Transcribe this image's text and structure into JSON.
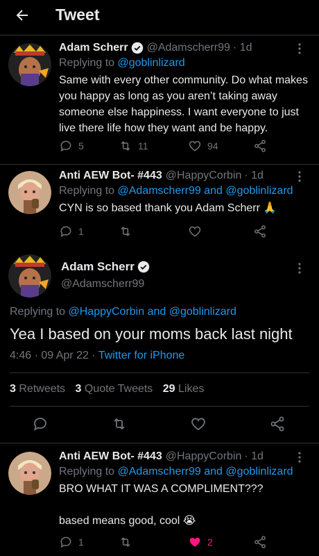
{
  "header": {
    "title": "Tweet"
  },
  "tweets": [
    {
      "name": "Adam Scherr",
      "handle": "@Adamscherr99",
      "time": "· 1d",
      "replying_prefix": "Replying to ",
      "replying_to": "@goblinlizard",
      "text": "Same with every other community.  Do what makes you happy as long as you aren’t taking away someone else happiness.  I want everyone to just live there life how they want and be happy.",
      "replies": "5",
      "retweets": "11",
      "likes": "94"
    },
    {
      "name": "Anti AEW Bot- #443",
      "handle": "@HappyCorbin",
      "time": "· 1d",
      "replying_prefix": "Replying to ",
      "replying_to": "@Adamscherr99 and @goblinlizard",
      "text": "CYN is so based thank you Adam Scherr 🙏",
      "replies": "1",
      "retweets": "",
      "likes": ""
    },
    {
      "name": "Anti AEW Bot- #443",
      "handle": "@HappyCorbin",
      "time": "· 1d",
      "replying_prefix": "Replying to ",
      "replying_to": "@Adamscherr99 and @goblinlizard",
      "text_line1": "BRO WHAT IT WAS A COMPLIMENT???",
      "text_line2": "based means good, cool 😭",
      "replies": "1",
      "retweets": "",
      "likes": "2"
    }
  ],
  "main": {
    "name": "Adam Scherr",
    "handle": "@Adamscherr99",
    "replying_prefix": "Replying to ",
    "replying_to": "@HappyCorbin and @goblinlizard",
    "text": "Yea I based on your moms back last night",
    "time": "4:46 · 09 Apr 22 · ",
    "source": "Twitter for iPhone",
    "retweets_count": "3",
    "retweets_label": "Retweets",
    "quotes_count": "3",
    "quotes_label": "Quote Tweets",
    "likes_count": "29",
    "likes_label": "Likes"
  },
  "colors": {
    "accent": "#1d9bf0",
    "like": "#f91880",
    "muted": "#71767b",
    "divider": "#2f3336"
  }
}
